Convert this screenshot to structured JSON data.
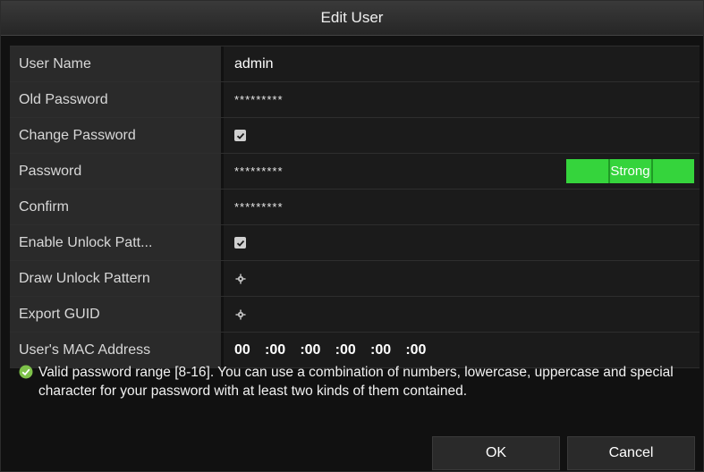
{
  "dialog": {
    "title": "Edit User"
  },
  "fields": {
    "user_name": {
      "label": "User Name",
      "value": "admin"
    },
    "old_password": {
      "label": "Old Password",
      "value": "*********"
    },
    "change_password": {
      "label": "Change Password",
      "checked": true
    },
    "password": {
      "label": "Password",
      "value": "*********",
      "strength": "Strong"
    },
    "confirm": {
      "label": "Confirm",
      "value": "*********"
    },
    "enable_unlock_pattern": {
      "label": "Enable Unlock Patt...",
      "checked": true
    },
    "draw_unlock_pattern": {
      "label": "Draw Unlock Pattern",
      "icon": "gear-icon"
    },
    "export_guid": {
      "label": "Export GUID",
      "icon": "gear-icon"
    },
    "mac_address": {
      "label": "User's MAC Address",
      "octets": [
        "00",
        "00",
        "00",
        "00",
        "00",
        "00"
      ],
      "separator": ":"
    }
  },
  "note": {
    "icon": "check-circle-icon",
    "text": "Valid password range [8-16]. You can use a combination of numbers, lowercase, uppercase and special character for your password with at least two kinds of them contained."
  },
  "buttons": {
    "ok_label": "OK",
    "cancel_label": "Cancel"
  },
  "colors": {
    "strength_bar": "#35d43c",
    "check_icon": "#7ec24a"
  }
}
